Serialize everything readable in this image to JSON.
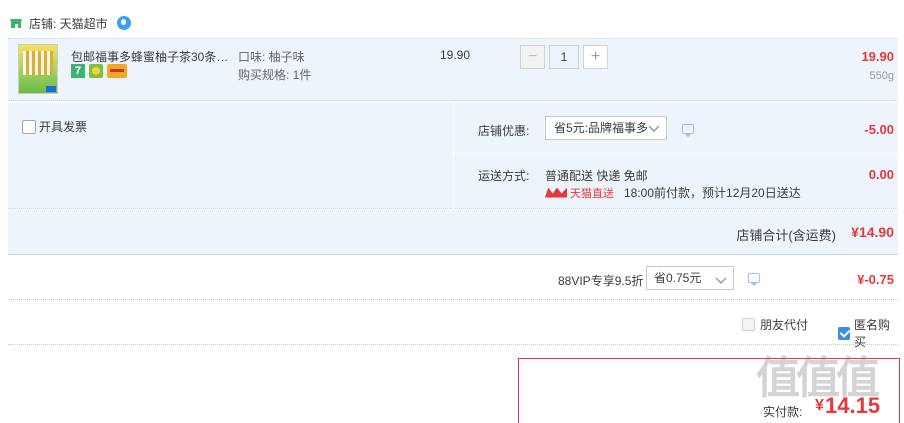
{
  "shop": {
    "label": "店铺: 天猫超市",
    "icon": "shop-icon",
    "chat_icon": "wangwang-icon"
  },
  "item": {
    "title": "包邮福事多蜂蜜柚子茶30条独...",
    "badges": [
      "7"
    ],
    "flavor": "口味: 柚子味",
    "spec": "购买规格: 1件",
    "unit_price": "19.90",
    "qty_minus": "−",
    "qty_value": "1",
    "qty_plus": "+",
    "line_total": "19.90",
    "weight": "550g"
  },
  "options": {
    "invoice_label": "开具发票",
    "discount_label": "店铺优惠:",
    "discount_select": "省5元:品牌福事多",
    "discount_value": "-5.00",
    "shipping_label": "运送方式:",
    "shipping_method": "普通配送 快递 免邮",
    "tmall_direct": "天猫直送",
    "shipping_time": "18:00前付款，预计12月20日送达",
    "shipping_value": "0.00"
  },
  "subtotal": {
    "label": "店铺合计(含运费)",
    "value": "¥14.90"
  },
  "vip": {
    "label": "88VIP专享9.5折",
    "select": "省0.75元",
    "value": "¥-0.75"
  },
  "agent": {
    "friend_pay": "朋友代付",
    "anonymous": "匿名购买"
  },
  "pay": {
    "label": "实付款:",
    "currency": "¥",
    "amount": "14.15"
  },
  "watermark": "值值值",
  "colors": {
    "accent": "#e4393c",
    "panel": "#eef4fb",
    "blue": "#3c8ee5"
  }
}
